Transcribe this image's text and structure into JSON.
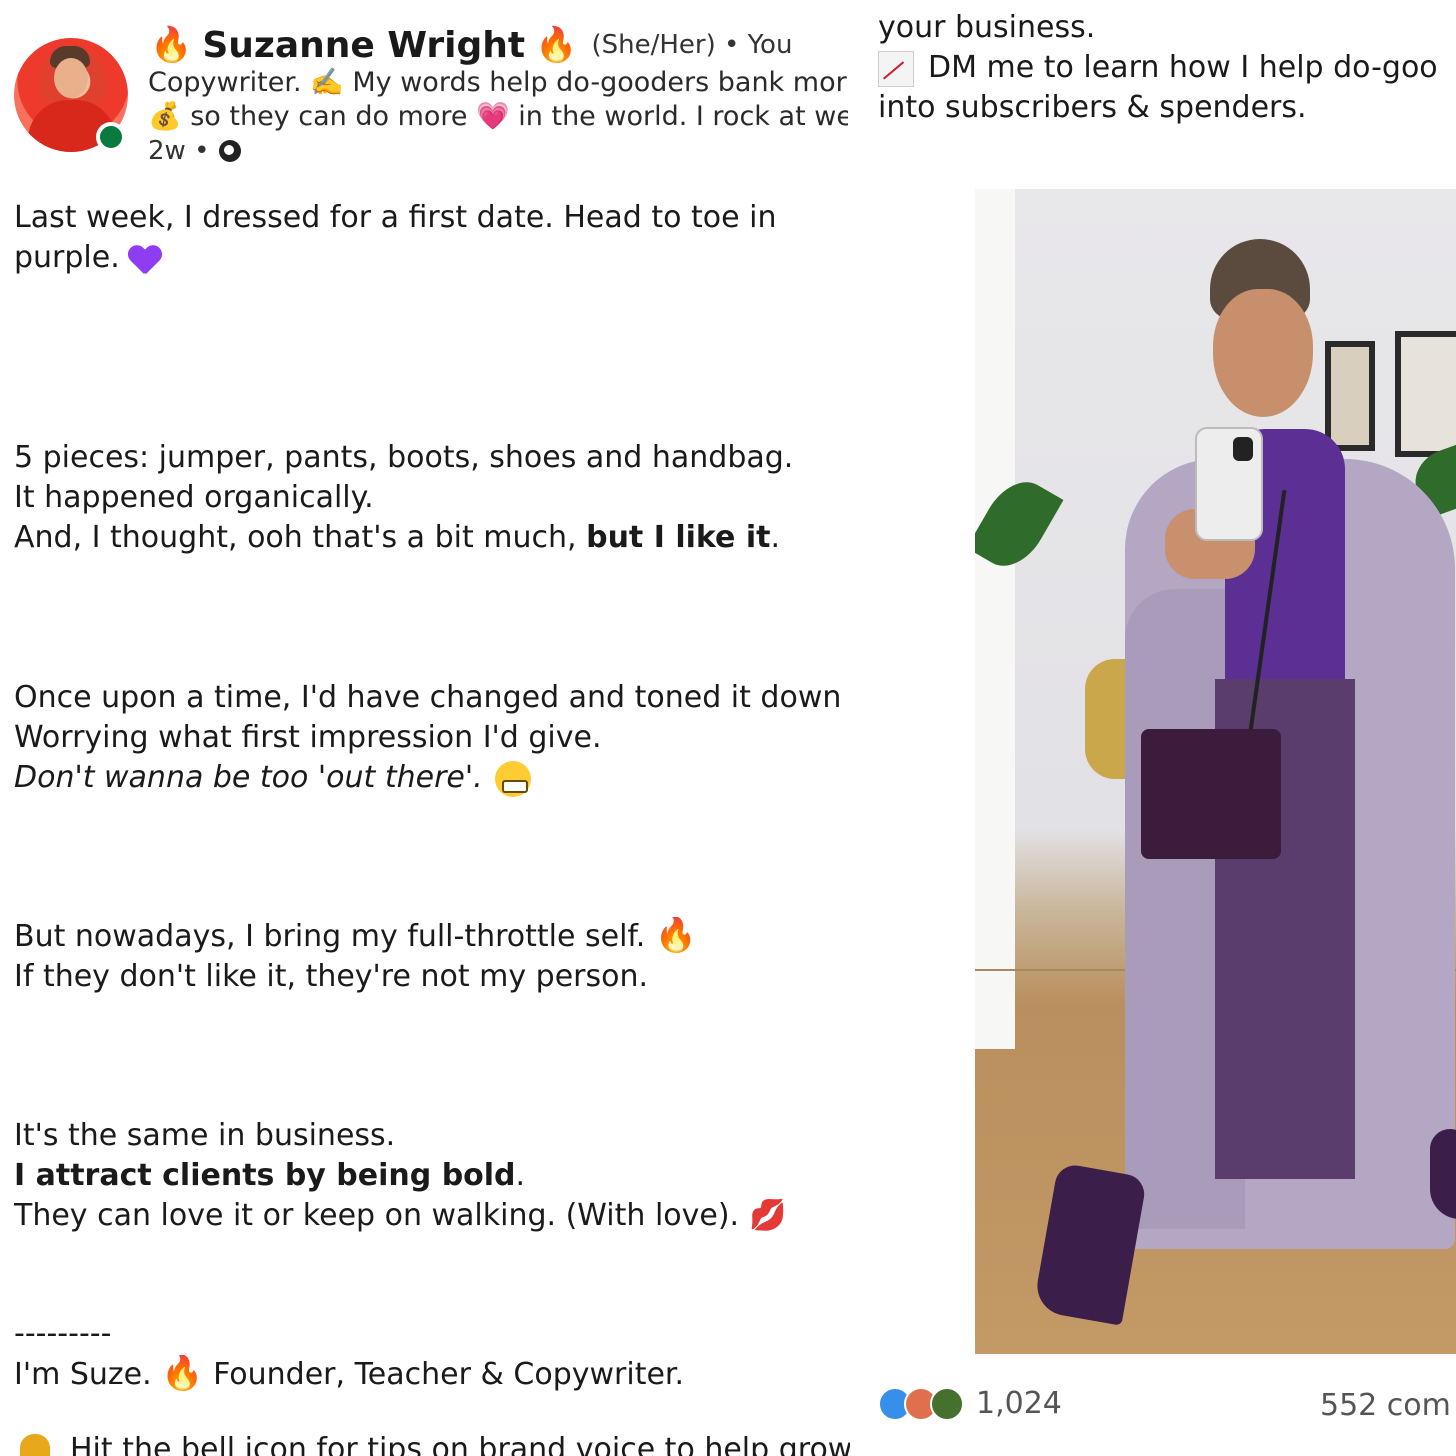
{
  "profile": {
    "name": "Suzanne Wright",
    "pronouns": "(She/Her) • You",
    "headline_1": "Copywriter. ✍️ My words help do-gooders bank mor",
    "headline_2": "💰 so they can do more 💗 in the world. I rock at we",
    "time": "2w •",
    "status_color": "#0b7a3e"
  },
  "post": {
    "l1": "Last week,  I dressed for a first date. Head to toe in",
    "l2": "purple.",
    "l3": "5 pieces: jumper, pants, boots, shoes and handbag.",
    "l4": "It happened organically.",
    "l5a": "And, I thought, ooh that's a bit much, ",
    "l5b": "but I like it",
    "l5c": ".",
    "l6": "Once upon a time, I'd have changed and toned it down",
    "l7": "Worrying what first impression I'd give.",
    "l8": "Don't wanna be too 'out there'.",
    "l9": "But nowadays, I bring my full-throttle self.",
    "l10": "If they don't like it, they're not my person.",
    "l11": "It's the same in business.",
    "l12a": "I attract clients by being bold",
    "l12b": ".",
    "l13": "They can love it or keep on walking. (With love).",
    "sep": "---------",
    "l14a": "I'm Suze.",
    "l14b": "Founder, Teacher & Copywriter.",
    "l15": "Hit the bell icon for tips on brand voice to help grow"
  },
  "right": {
    "r1": "your business.",
    "r2": "DM me to learn how I help do-goo",
    "r3": "into subscribers & spenders.",
    "reactions_count": "1,024",
    "comments": "552 com"
  },
  "icons": {
    "fire": "fire-icon",
    "heart": "purple-heart-icon",
    "globe": "globe-icon",
    "chart": "chart-increasing-icon",
    "bell": "bell-icon",
    "kiss": "kiss-mark-icon"
  }
}
